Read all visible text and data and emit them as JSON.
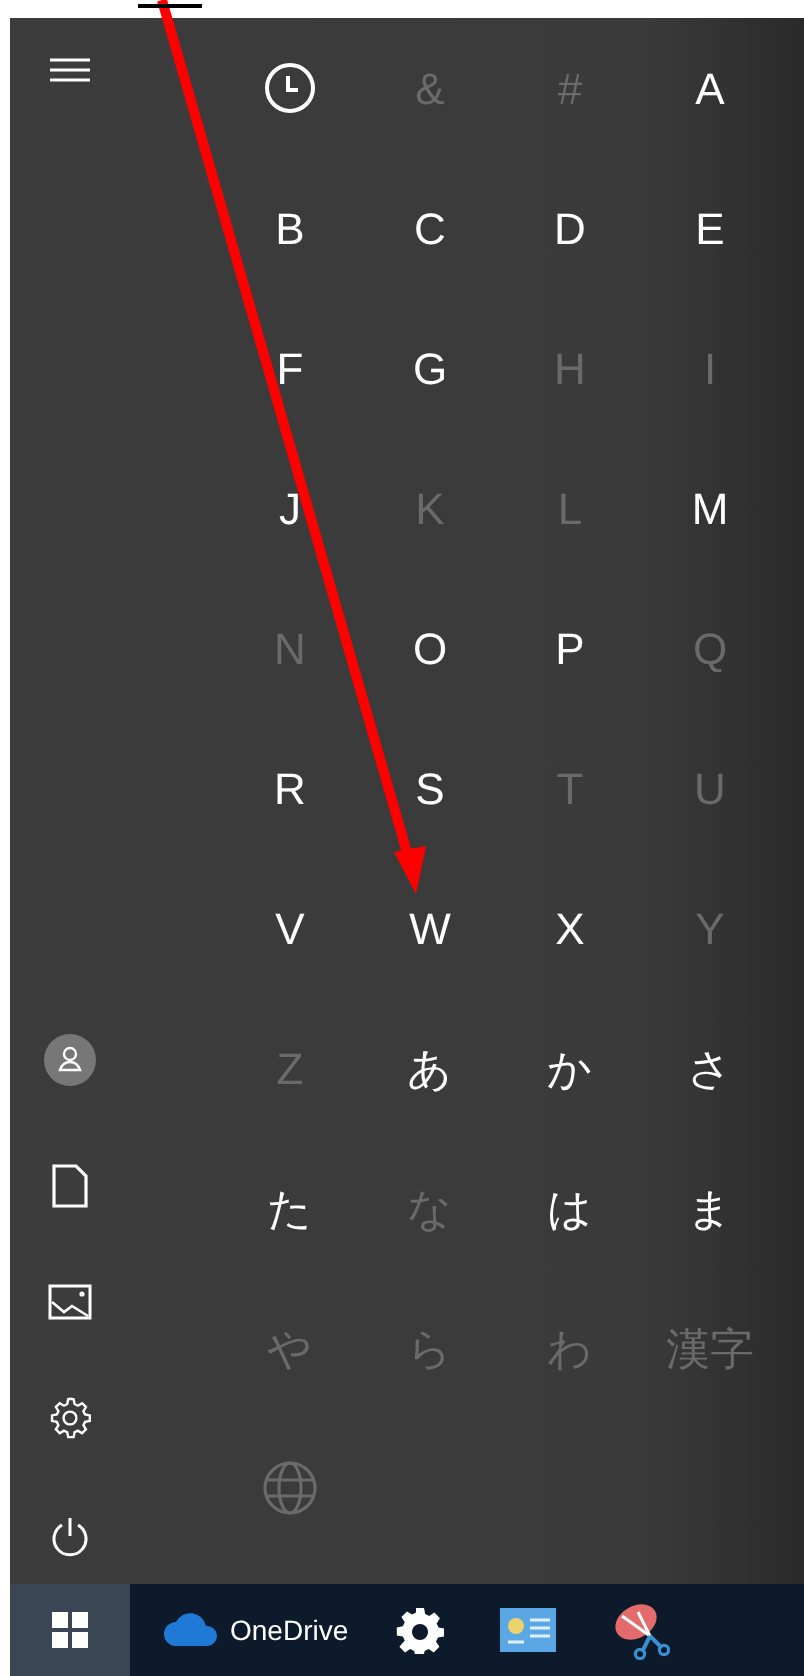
{
  "sidebar": {
    "items": [
      {
        "kind": "menu"
      },
      {
        "kind": "user"
      },
      {
        "kind": "documents"
      },
      {
        "kind": "pictures"
      },
      {
        "kind": "settings"
      },
      {
        "kind": "power"
      }
    ]
  },
  "index_grid": [
    {
      "kind": "recent",
      "disabled": false
    },
    {
      "kind": "letter",
      "label": "&",
      "disabled": true
    },
    {
      "kind": "letter",
      "label": "#",
      "disabled": true
    },
    {
      "kind": "letter",
      "label": "A",
      "disabled": false
    },
    {
      "kind": "letter",
      "label": "B",
      "disabled": false
    },
    {
      "kind": "letter",
      "label": "C",
      "disabled": false
    },
    {
      "kind": "letter",
      "label": "D",
      "disabled": false
    },
    {
      "kind": "letter",
      "label": "E",
      "disabled": false
    },
    {
      "kind": "letter",
      "label": "F",
      "disabled": false
    },
    {
      "kind": "letter",
      "label": "G",
      "disabled": false
    },
    {
      "kind": "letter",
      "label": "H",
      "disabled": true
    },
    {
      "kind": "letter",
      "label": "I",
      "disabled": true
    },
    {
      "kind": "letter",
      "label": "J",
      "disabled": false
    },
    {
      "kind": "letter",
      "label": "K",
      "disabled": true
    },
    {
      "kind": "letter",
      "label": "L",
      "disabled": true
    },
    {
      "kind": "letter",
      "label": "M",
      "disabled": false
    },
    {
      "kind": "letter",
      "label": "N",
      "disabled": true
    },
    {
      "kind": "letter",
      "label": "O",
      "disabled": false
    },
    {
      "kind": "letter",
      "label": "P",
      "disabled": false
    },
    {
      "kind": "letter",
      "label": "Q",
      "disabled": true
    },
    {
      "kind": "letter",
      "label": "R",
      "disabled": false
    },
    {
      "kind": "letter",
      "label": "S",
      "disabled": false
    },
    {
      "kind": "letter",
      "label": "T",
      "disabled": true
    },
    {
      "kind": "letter",
      "label": "U",
      "disabled": true
    },
    {
      "kind": "letter",
      "label": "V",
      "disabled": false
    },
    {
      "kind": "letter",
      "label": "W",
      "disabled": false
    },
    {
      "kind": "letter",
      "label": "X",
      "disabled": false
    },
    {
      "kind": "letter",
      "label": "Y",
      "disabled": true
    },
    {
      "kind": "letter",
      "label": "Z",
      "disabled": true
    },
    {
      "kind": "letter",
      "label": "あ",
      "disabled": false
    },
    {
      "kind": "letter",
      "label": "か",
      "disabled": false
    },
    {
      "kind": "letter",
      "label": "さ",
      "disabled": false
    },
    {
      "kind": "letter",
      "label": "た",
      "disabled": false
    },
    {
      "kind": "letter",
      "label": "な",
      "disabled": true
    },
    {
      "kind": "letter",
      "label": "は",
      "disabled": false
    },
    {
      "kind": "letter",
      "label": "ま",
      "disabled": false
    },
    {
      "kind": "letter",
      "label": "や",
      "disabled": true
    },
    {
      "kind": "letter",
      "label": "ら",
      "disabled": true
    },
    {
      "kind": "letter",
      "label": "わ",
      "disabled": true
    },
    {
      "kind": "letter",
      "label": "漢字",
      "disabled": true
    },
    {
      "kind": "globe",
      "disabled": true
    }
  ],
  "taskbar": {
    "items": [
      {
        "kind": "start",
        "selected": true
      },
      {
        "kind": "onedrive",
        "label": "OneDrive",
        "selected": false
      },
      {
        "kind": "settings",
        "selected": false
      },
      {
        "kind": "control-panel",
        "selected": false
      },
      {
        "kind": "snipping",
        "selected": false
      }
    ]
  }
}
